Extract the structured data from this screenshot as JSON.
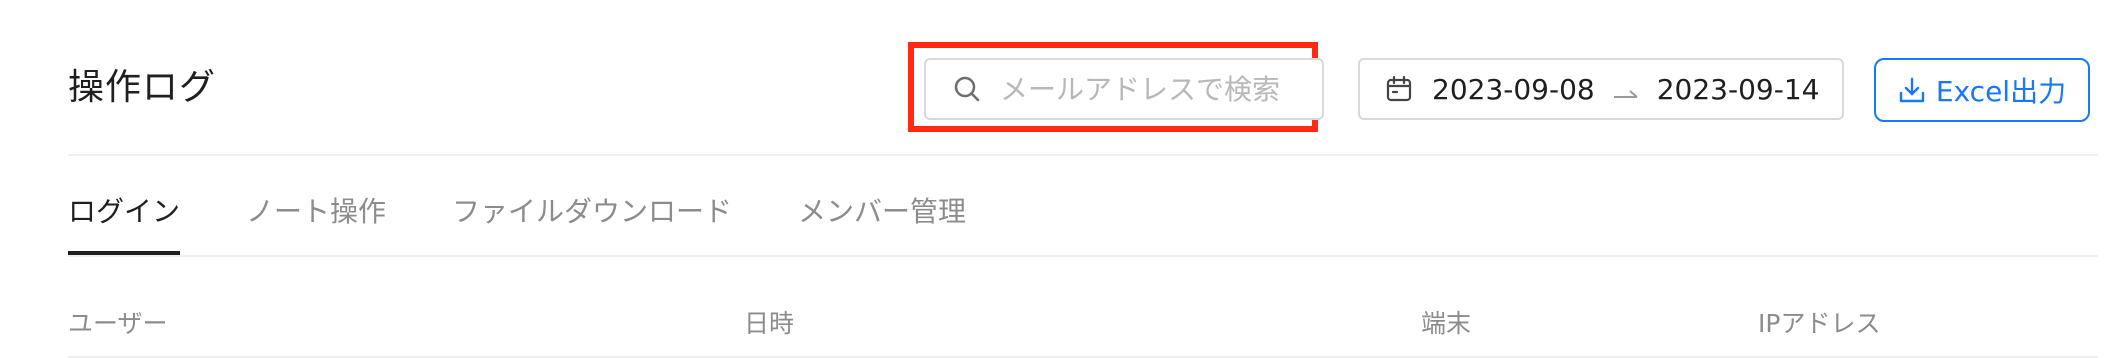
{
  "header": {
    "title": "操作ログ",
    "search": {
      "placeholder": "メールアドレスで検索",
      "value": ""
    },
    "date_range": {
      "start": "2023-09-08",
      "end": "2023-09-14"
    },
    "export_button_label": "Excel出力"
  },
  "tabs": [
    {
      "label": "ログイン",
      "active": true
    },
    {
      "label": "ノート操作",
      "active": false
    },
    {
      "label": "ファイルダウンロード",
      "active": false
    },
    {
      "label": "メンバー管理",
      "active": false
    }
  ],
  "table": {
    "columns": [
      "ユーザー",
      "日時",
      "端末",
      "IPアドレス"
    ],
    "rows": []
  },
  "colors": {
    "accent": "#1677ff",
    "highlight": "#ff2a12",
    "border": "#d9d9d9",
    "text_primary": "#1f1f1f",
    "text_secondary": "#8c8c8c"
  },
  "icons": {
    "search": "search-icon",
    "calendar": "calendar-icon",
    "arrow": "arrow-right-icon",
    "download": "download-icon"
  }
}
